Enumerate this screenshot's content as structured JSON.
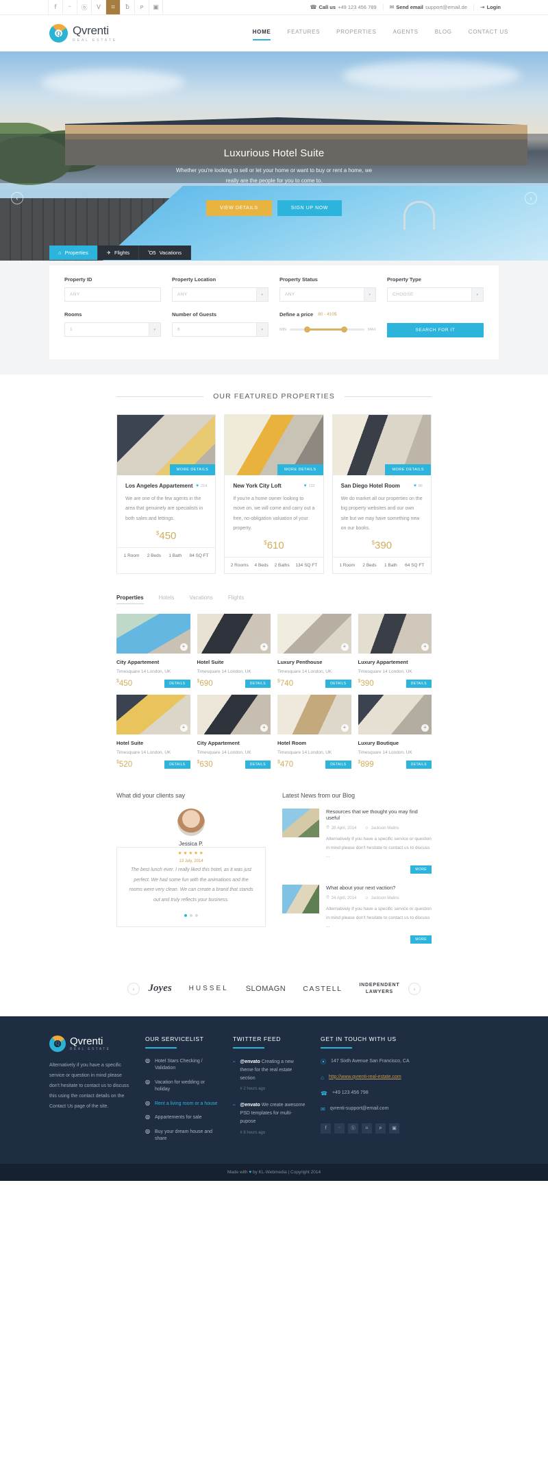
{
  "topbar": {
    "social": [
      {
        "name": "facebook-icon",
        "glyph": "f"
      },
      {
        "name": "twitter-icon",
        "glyph": "ᵕ"
      },
      {
        "name": "dribbble-icon",
        "glyph": "ⓑ"
      },
      {
        "name": "vimeo-icon",
        "glyph": "V"
      },
      {
        "name": "instagram-icon",
        "glyph": "⌗"
      },
      {
        "name": "behance-icon",
        "glyph": "ƀ"
      },
      {
        "name": "pinterest-icon",
        "glyph": "ᴘ"
      },
      {
        "name": "flickr-icon",
        "glyph": "▣"
      }
    ],
    "call_label": "Call us",
    "call_value": "+49 123 456 789",
    "email_label": "Send email",
    "email_value": "support@email.de",
    "login_label": "Login"
  },
  "header": {
    "brand_name": "Qvrenti",
    "brand_tagline": "REAL ESTATE",
    "nav": [
      {
        "label": "HOME",
        "active": true
      },
      {
        "label": "FEATURES",
        "active": false
      },
      {
        "label": "PROPERTIES",
        "active": false
      },
      {
        "label": "AGENTS",
        "active": false
      },
      {
        "label": "BLOG",
        "active": false
      },
      {
        "label": "CONTACT US",
        "active": false
      }
    ]
  },
  "hero": {
    "title": "Luxurious Hotel Suite",
    "subtitle": "Whether you're looking to sell or let your home or want to buy or rent a home, we really are the people for you to come to.",
    "btn_primary": "VIEW DETAILS",
    "btn_secondary": "SIGN UP NOW",
    "arrow_left": "‹",
    "arrow_right": "›"
  },
  "search": {
    "tabs": [
      {
        "label": "Properties",
        "icon": "⌂",
        "active": true
      },
      {
        "label": "Flights",
        "icon": "✈",
        "active": false
      },
      {
        "label": "Vacations",
        "icon": "Ὄ5",
        "active": false
      }
    ],
    "fields": [
      {
        "label": "Property ID",
        "value": "ANY",
        "type": "input"
      },
      {
        "label": "Property Location",
        "value": "ANY",
        "type": "select"
      },
      {
        "label": "Property Status",
        "value": "ANY",
        "type": "select"
      },
      {
        "label": "Property Type",
        "value": "CHOOSE",
        "type": "select"
      }
    ],
    "rooms_label": "Rooms",
    "rooms_value": "1",
    "guests_label": "Number of Guests",
    "guests_value": "6",
    "price_label": "Define a price",
    "price_range": "80 - 410$",
    "slider_min": "MIN",
    "slider_max": "MAX",
    "submit_label": "SEARCH FOR IT"
  },
  "featured": {
    "section_title": "OUR FEATURED PROPERTIES",
    "more_details_label": "MORE DETAILS",
    "cards": [
      {
        "name": "Los Angeles Appartement",
        "likes": "214",
        "desc": "We are one of the few agents in the area that genuinely are specialists in both sales and lettings.",
        "price": "450",
        "currency": "$",
        "specs": [
          "1 Room",
          "2 Beds",
          "1 Bath",
          "84 SQ FT"
        ]
      },
      {
        "name": "New York City Loft",
        "likes": "132",
        "desc": "If you're a home owner looking to move on, we will come and carry out a free, no-obligation valuation of your property.",
        "price": "610",
        "currency": "$",
        "specs": [
          "2 Rooms",
          "4 Beds",
          "2 Baths",
          "134 SQ FT"
        ]
      },
      {
        "name": "San Diego Hotel Room",
        "likes": "86",
        "desc": "We do market all our properties on the big property websites and our own site but we may have something new on our books.",
        "price": "390",
        "currency": "$",
        "specs": [
          "1 Room",
          "2 Beds",
          "1 Bath",
          "64 SQ FT"
        ]
      }
    ]
  },
  "listings": {
    "tabs": [
      {
        "label": "Properties",
        "active": true
      },
      {
        "label": "Hotels",
        "active": false
      },
      {
        "label": "Vacations",
        "active": false
      },
      {
        "label": "Flights",
        "active": false
      }
    ],
    "details_label": "DETAILS",
    "items": [
      {
        "name": "City Appartement",
        "location": "Timesquare 14 London, UK",
        "price": "450",
        "currency": "$"
      },
      {
        "name": "Hotel Suite",
        "location": "Timesquare 14 London, UK",
        "price": "690",
        "currency": "$"
      },
      {
        "name": "Luxury Penthouse",
        "location": "Timesquare 14 London, UK",
        "price": "740",
        "currency": "$"
      },
      {
        "name": "Luxury Appartement",
        "location": "Timesquare 14 London, UK",
        "price": "390",
        "currency": "$"
      },
      {
        "name": "Hotel Suite",
        "location": "Timesquare 14 London, UK",
        "price": "520",
        "currency": "$"
      },
      {
        "name": "City Appartement",
        "location": "Timesquare 14 London, UK",
        "price": "630",
        "currency": "$"
      },
      {
        "name": "Hotel Room",
        "location": "Timesquare 14 London, UK",
        "price": "470",
        "currency": "$"
      },
      {
        "name": "Luxury Boutique",
        "location": "Timesquare 14 London, UK",
        "price": "899",
        "currency": "$"
      }
    ]
  },
  "testimonial": {
    "heading": "What did your clients say",
    "author": "Jessica P.",
    "date": "13 July, 2014",
    "stars": "★★★★★",
    "quote": "The best lunch ever. I really liked this hotel, as it was just perfect. We had some fun with the animations and the rooms were very clean. We can create a brand that stands out and truly reflects your business."
  },
  "blog": {
    "heading": "Latest News from our Blog",
    "more_label": "MORE",
    "posts": [
      {
        "title": "Resources that we thought you may find useful",
        "date": "28 April, 2014",
        "author": "Jackson Malins",
        "excerpt": "Alternatively if you have a specific service or question in mind please don't hesitate to contact us to discuss ..."
      },
      {
        "title": "What about your next vaction?",
        "date": "24 April, 2014",
        "author": "Jackson Malins",
        "excerpt": "Alternatively if you have a specific service or question in mind please don't hesitate to contact us to discuss ..."
      }
    ]
  },
  "brands": {
    "arrow_left": "‹",
    "arrow_right": "›",
    "items": [
      "Joyes",
      "HUSSEL",
      "SLOMAGN",
      "CASTELL",
      "INDEPENDENT LAWYERS"
    ]
  },
  "footer": {
    "brand_name": "Qvrenti",
    "brand_tagline": "REAL ESTATE",
    "about_text": "Alternatively if you have a specific service or question in mind please don't hesitate to contact us to discuss this using the contact details on the Contact Us page of the site.",
    "services_heading": "OUR SERVICELIST",
    "services": [
      {
        "label": "Hotel Stars Checking / Validation",
        "highlight": false
      },
      {
        "label": "Vacation for wedding or holiday",
        "highlight": false
      },
      {
        "label": "Rent a living room or a house",
        "highlight": true
      },
      {
        "label": "Appartements for sale",
        "highlight": false
      },
      {
        "label": "Buy your dream house and share",
        "highlight": false
      }
    ],
    "twitter_heading": "TWITTER FEED",
    "tweets": [
      {
        "handle": "@envato",
        "text": "Creating a new theme for the real estate section",
        "time": "# 2 hours ago"
      },
      {
        "handle": "@envato",
        "text": "We create awesome PSD templates for multi-pupose",
        "time": "# 8 hours ago"
      }
    ],
    "contact_heading": "GET IN TOUCH WITH US",
    "contact": [
      {
        "icon": "⦿",
        "text": "147 Sixth Avenue San Francisco, CA",
        "link": false
      },
      {
        "icon": "⌂",
        "text": "http://www.qvrenti-real-estate.com",
        "link": true
      },
      {
        "icon": "☎",
        "text": "+49 123 456 798",
        "link": false
      },
      {
        "icon": "✉",
        "text": "qvrenti-support@email.com",
        "link": false
      }
    ],
    "social": [
      "f",
      "ᵕ",
      "ⓑ",
      "⌗",
      "ᴘ",
      "▣"
    ],
    "bottom_text_pre": "Made with",
    "bottom_heart": "♥",
    "bottom_text_post": "by KL-Webmedia | Copyright 2014"
  },
  "colors": {
    "accent_blue": "#2cb4dd",
    "accent_gold": "#d3ab5c",
    "footer_bg": "#1e2d42"
  }
}
